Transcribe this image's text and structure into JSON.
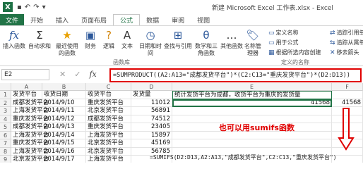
{
  "window": {
    "title": "新建 Microsoft Excel 工作表.xlsx - Excel",
    "app_icon": "X"
  },
  "tabs": [
    "文件",
    "开始",
    "插入",
    "页面布局",
    "公式",
    "数据",
    "审阅",
    "视图"
  ],
  "active_tab": "公式",
  "ribbon": {
    "insert_function": "插入函数",
    "autosum": "自动求和",
    "recent": "最近使用的函数",
    "financial": "财务",
    "logical": "逻辑",
    "text": "文本",
    "datetime": "日期和时间",
    "lookup": "查找与引用",
    "math": "数学和三角函数",
    "more": "其他函数",
    "library_group": "函数库",
    "name_manager": "名称管理器",
    "define_name": "定义名称",
    "use_in_formula": "用于公式",
    "create_from_selection": "根据所选内容创建",
    "defined_names_group": "定义的名称",
    "trace_precedents": "追踪引用单",
    "trace_dependents": "追踪从属单",
    "remove_arrows": "移去箭头"
  },
  "formula_bar": {
    "name_box": "E2",
    "formula": "=SUMPRODUCT((A2:A13=\"成都发货平台\")*(C2:C13=\"重庆发货平台\")*(D2:D13))"
  },
  "columns": [
    "A",
    "B",
    "C",
    "D",
    "E",
    "F"
  ],
  "rows": [
    {
      "n": "1",
      "a": "发货平台",
      "b": "收货日期",
      "c": "收货平台",
      "d": "发货量",
      "e": "统计发货平台为成都，收货平台为重庆的发货量",
      "f": ""
    },
    {
      "n": "2",
      "a": "成都发货平台",
      "b": "2014/9/10",
      "c": "重庆发货平台",
      "d": "11012",
      "e": "41568",
      "f": "41568"
    },
    {
      "n": "3",
      "a": "上海发货平台",
      "b": "2014/9/11",
      "c": "北京发货平台",
      "d": "56891",
      "e": "",
      "f": ""
    },
    {
      "n": "4",
      "a": "重庆发货平台",
      "b": "2014/9/12",
      "c": "成都发货平台",
      "d": "74512",
      "e": "",
      "f": ""
    },
    {
      "n": "5",
      "a": "成都发货平台",
      "b": "2014/9/13",
      "c": "重庆发货平台",
      "d": "23405",
      "e": "",
      "f": ""
    },
    {
      "n": "6",
      "a": "上海发货平台",
      "b": "2014/9/14",
      "c": "上海发货平台",
      "d": "15897",
      "e": "",
      "f": ""
    },
    {
      "n": "7",
      "a": "重庆发货平台",
      "b": "2014/9/15",
      "c": "北京发货平台",
      "d": "45169",
      "e": "",
      "f": ""
    },
    {
      "n": "8",
      "a": "上海发货平台",
      "b": "2014/9/16",
      "c": "北京发货平台",
      "d": "56785",
      "e": "",
      "f": ""
    },
    {
      "n": "9",
      "a": "北京发货平台",
      "b": "2014/9/17",
      "c": "上海发货平台",
      "d": "",
      "e": "",
      "f": ""
    }
  ],
  "annotation": "也可以用sumifs函数",
  "sumifs_formula": "=SUMIFS(D2:D13,A2:A13,\"成都发货平台\",C2:C13,\"重庆发货平台\")",
  "colors": {
    "accent": "#217346",
    "highlight": "#e00000"
  }
}
